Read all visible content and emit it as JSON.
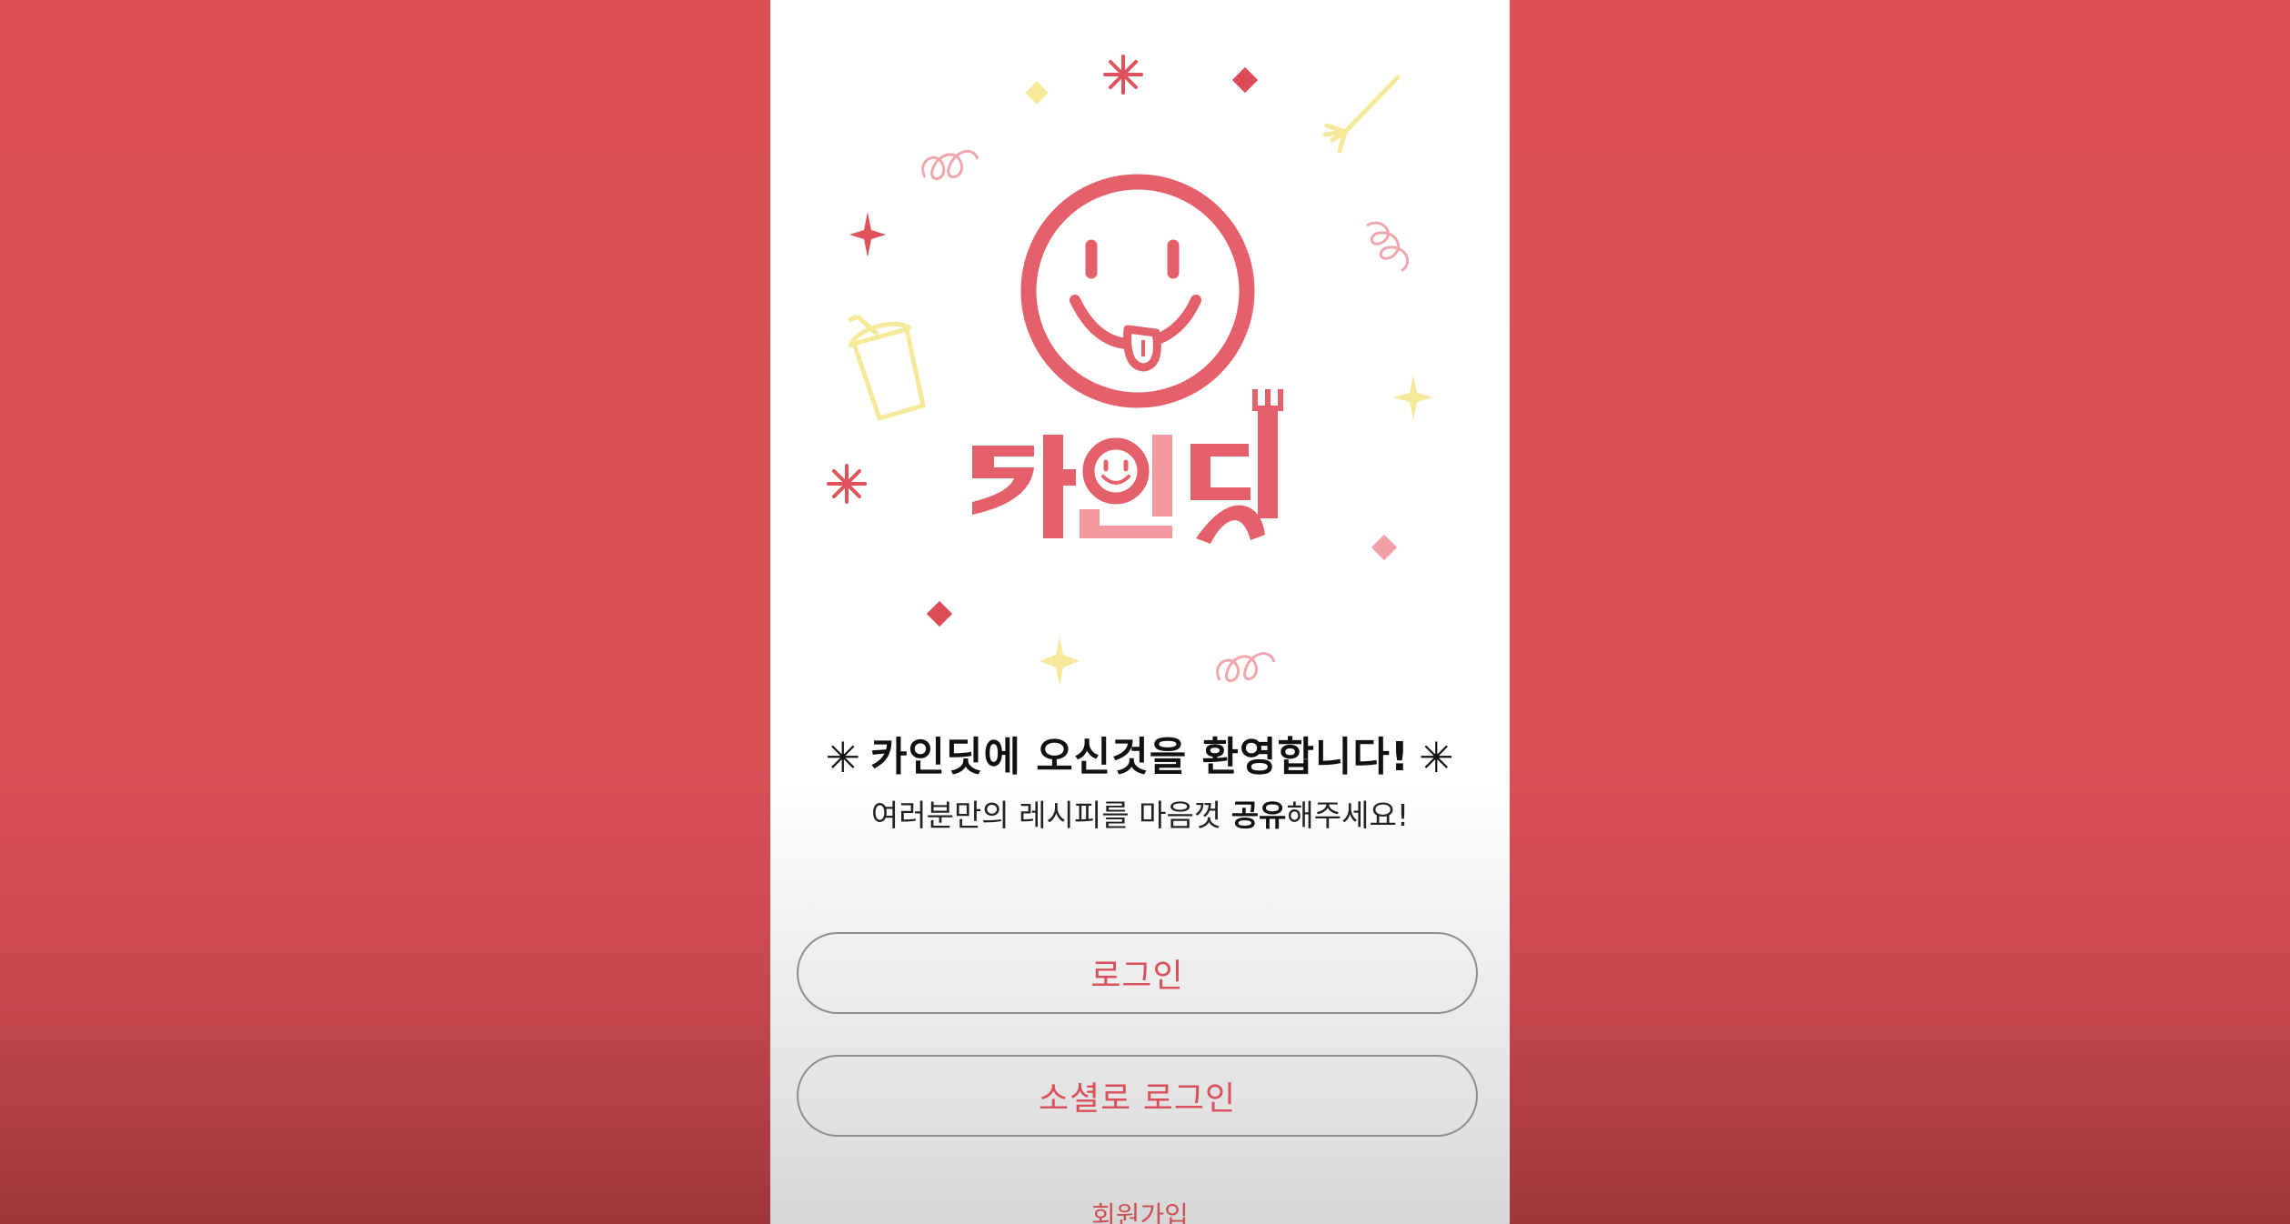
{
  "app": {
    "logo_text": "카인딧",
    "welcome_title": "카인딧에 오신것을 환영합니다!",
    "welcome_star": "✳",
    "subtitle_prefix": "여러분만의 레시피를 마음껏 ",
    "subtitle_bold": "공유",
    "subtitle_suffix": "해주세요!"
  },
  "buttons": {
    "login_label": "로그인",
    "social_login_label": "소셜로 로그인"
  },
  "links": {
    "signup_label": "회원가입"
  },
  "colors": {
    "background_red": "#dc4f57",
    "brand_pink": "#e4606a",
    "brand_light_pink": "#f29a9f",
    "accent_yellow": "#f6ea9a",
    "button_text": "#d9505a"
  },
  "icons": {
    "logo": "smiley-tongue-icon",
    "decorations": [
      "asterisk-icon",
      "diamond-icon",
      "fork-icon",
      "swirl-icon",
      "sparkle-icon",
      "drink-cup-icon"
    ]
  }
}
